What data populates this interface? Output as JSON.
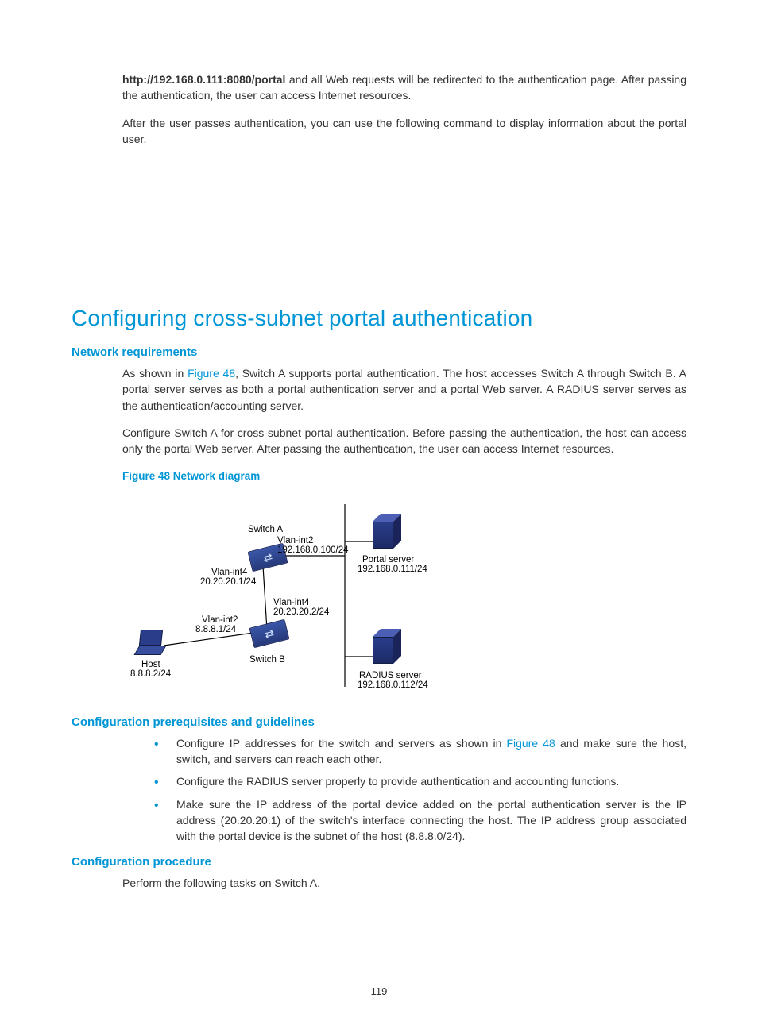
{
  "intro": {
    "url_bold": "http://192.168.0.111:8080/portal",
    "p1_rest": " and all Web requests will be redirected to the authentication page. After passing the authentication, the user can access Internet resources.",
    "p2": "After the user passes authentication, you can use the following command to display information about the portal user."
  },
  "section_title": "Configuring cross-subnet portal authentication",
  "network_req": {
    "heading": "Network requirements",
    "p1_a": "As shown in ",
    "fig_link": "Figure 48",
    "p1_b": ", Switch A supports portal authentication. The host accesses Switch A through Switch B. A portal server serves as both a portal authentication server and a portal Web server. A RADIUS server serves as the authentication/accounting server.",
    "p2": "Configure Switch A for cross-subnet portal authentication. Before passing the authentication, the host can access only the portal Web server. After passing the authentication, the user can access Internet resources."
  },
  "figure_caption": "Figure 48 Network diagram",
  "diagram": {
    "switchA": "Switch A",
    "switchA_vlan2": "Vlan-int2",
    "switchA_vlan2_ip": "192.168.0.100/24",
    "switchA_vlan4": "Vlan-int4",
    "switchA_vlan4b": "20.20.20.1/24",
    "switchB": "Switch B",
    "switchB_vlan4": "Vlan-int4",
    "switchB_vlan4_ip": "20.20.20.2/24",
    "switchB_vlan2": "Vlan-int2",
    "switchB_vlan2_ip": "8.8.8.1/24",
    "host": "Host",
    "host_ip": "8.8.8.2/24",
    "portal": "Portal server",
    "portal_ip": "192.168.0.111/24",
    "radius": "RADIUS server",
    "radius_ip": "192.168.0.112/24"
  },
  "prereq": {
    "heading": "Configuration prerequisites and guidelines",
    "b1_a": "Configure IP addresses for the switch and servers as shown in ",
    "b1_link": "Figure 48",
    "b1_b": " and make sure the host, switch, and servers can reach each other.",
    "b2": "Configure the RADIUS server properly to provide authentication and accounting functions.",
    "b3": "Make sure the IP address of the portal device added on the portal authentication server is the IP address (20.20.20.1) of the switch's interface connecting the host. The IP address group associated with the portal device is the subnet of the host (8.8.8.0/24)."
  },
  "procedure": {
    "heading": "Configuration procedure",
    "p1": "Perform the following tasks on Switch A."
  },
  "page_number": "119"
}
